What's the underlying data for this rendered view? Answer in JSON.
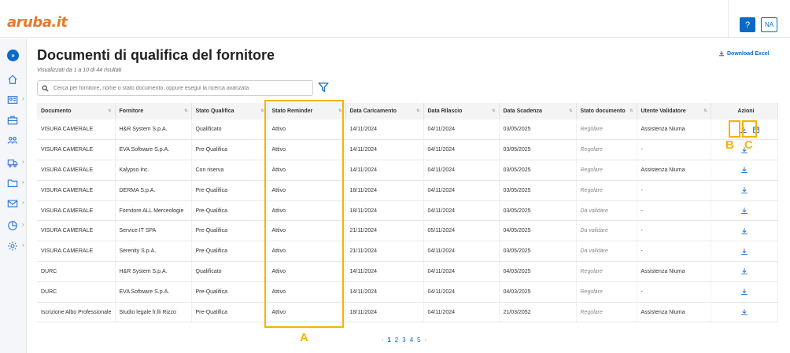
{
  "header": {
    "logo_text": "aruba.it",
    "help_label": "?",
    "user_initials": "NA",
    "accent": "#0a6ac7",
    "logo_color": "#e8772e"
  },
  "sidebar": {
    "toggle_label": "»",
    "items": [
      {
        "icon": "home-icon"
      },
      {
        "icon": "contacts-icon"
      },
      {
        "icon": "briefcase-icon"
      },
      {
        "icon": "people-icon"
      },
      {
        "icon": "truck-icon"
      },
      {
        "icon": "folder-icon"
      },
      {
        "icon": "mail-icon"
      },
      {
        "icon": "chart-icon"
      },
      {
        "icon": "gear-icon"
      }
    ]
  },
  "page": {
    "title": "Documenti di qualifica del fornitore",
    "results_info": "Visualizzati da 1 a 10 di 44 risultati",
    "download_excel": "Download Excel",
    "search_placeholder": "Cerca per fornitore, nome o stato documento, oppure esegui la ricerca avanzata"
  },
  "table": {
    "columns": [
      "Documento",
      "Fornitore",
      "Stato Qualifica",
      "Stato Reminder",
      "Data Caricamento",
      "Data Rilascio",
      "Data Scadenza",
      "Stato documento",
      "Utente Validatore",
      "Azioni"
    ],
    "rows": [
      [
        "VISURA CAMERALE",
        "H&R System S.p.A.",
        "Qualificato",
        "Attivo",
        "14/11/2024",
        "04/11/2024",
        "03/05/2025",
        "Regolare",
        "Assistenza Niuma"
      ],
      [
        "VISURA CAMERALE",
        "EVA Software S.p.A.",
        "Pre-Qualifica",
        "Attivo",
        "14/11/2024",
        "04/11/2024",
        "03/05/2025",
        "Regolare",
        "-"
      ],
      [
        "VISURA CAMERALE",
        "Kalypso Inc.",
        "Con riserva",
        "Attivo",
        "14/11/2024",
        "04/11/2024",
        "03/05/2025",
        "Regolare",
        "Assistenza Niuma"
      ],
      [
        "VISURA CAMERALE",
        "DERMA S.p.A.",
        "Pre-Qualifica",
        "Attivo",
        "18/11/2024",
        "04/11/2024",
        "03/05/2025",
        "Regolare",
        "-"
      ],
      [
        "VISURA CAMERALE",
        "Fornitore ALL Merceologie",
        "Pre-Qualifica",
        "Attivo",
        "18/11/2024",
        "04/11/2024",
        "03/05/2025",
        "Da validare",
        "-"
      ],
      [
        "VISURA CAMERALE",
        "Service IT SPA",
        "Pre-Qualifica",
        "Attivo",
        "21/11/2024",
        "05/11/2024",
        "04/05/2025",
        "Da validare",
        "-"
      ],
      [
        "VISURA CAMERALE",
        "Serenity S.p.A.",
        "Pre-Qualifica",
        "Attivo",
        "21/11/2024",
        "04/11/2024",
        "03/05/2025",
        "Da validare",
        "-"
      ],
      [
        "DURC",
        "H&R System S.p.A.",
        "Qualificato",
        "Attivo",
        "14/11/2024",
        "04/11/2024",
        "04/03/2025",
        "Regolare",
        "Assistenza Niuma"
      ],
      [
        "DURC",
        "EVA Software S.p.A.",
        "Pre-Qualifica",
        "Attivo",
        "14/11/2024",
        "04/11/2024",
        "04/03/2025",
        "Regolare",
        "-"
      ],
      [
        "Iscrizione Albo Professionale",
        "Studio legale fr.lli Rizzo",
        "Pre-Qualifica",
        "Attivo",
        "18/11/2024",
        "04/11/2024",
        "21/03/2052",
        "Regolare",
        "Assistenza Niuma"
      ]
    ]
  },
  "annotations": {
    "a": "A",
    "b": "B",
    "c": "C",
    "color": "#f5b400"
  },
  "pagination": {
    "prev": "‹",
    "pages": [
      "1",
      "2",
      "3",
      "4",
      "5"
    ],
    "next": "›"
  }
}
